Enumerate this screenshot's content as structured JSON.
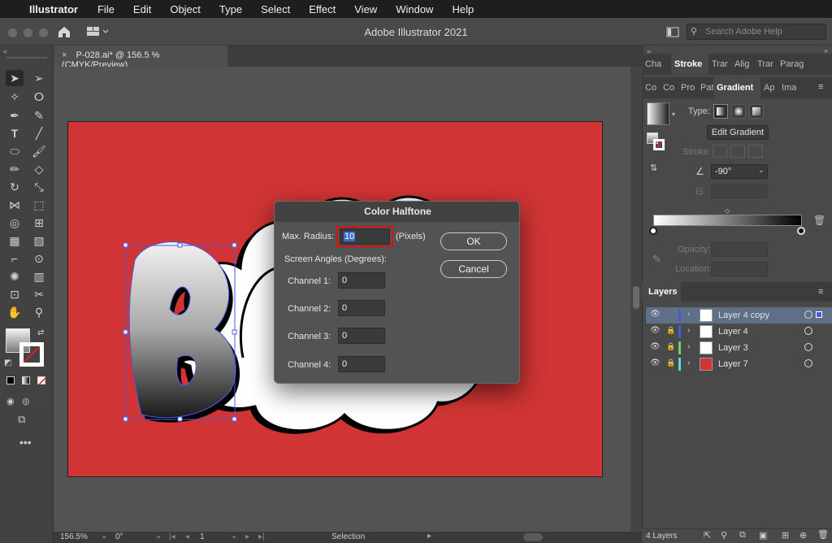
{
  "menubar": {
    "app": "Illustrator",
    "items": [
      "File",
      "Edit",
      "Object",
      "Type",
      "Select",
      "Effect",
      "View",
      "Window",
      "Help"
    ]
  },
  "titlebar": {
    "title": "Adobe Illustrator 2021",
    "search_placeholder": "Search Adobe Help"
  },
  "document": {
    "tab_label": "P-028.ai* @ 156.5 % (CMYK/Preview)"
  },
  "panels": {
    "top_tabs": [
      "Cha",
      "Stroke",
      "Trar",
      "Alig",
      "Trar",
      "Parag"
    ],
    "top_active": "Stroke",
    "gradient_tabs": [
      "Co",
      "Co",
      "Pro",
      "Pat",
      "Gradient",
      "Ap",
      "Ima"
    ],
    "gradient_active": "Gradient",
    "gradient": {
      "type_label": "Type:",
      "edit_button": "Edit Gradient",
      "stroke_label": "Stroke:",
      "angle": "-90°",
      "opacity_label": "Opacity:",
      "location_label": "Location:"
    }
  },
  "layers": {
    "title": "Layers",
    "rows": [
      {
        "name": "Layer 4 copy",
        "color": "#4a5bd8",
        "locked": false,
        "selected": true
      },
      {
        "name": "Layer 4",
        "color": "#4a5bd8",
        "locked": true,
        "selected": false
      },
      {
        "name": "Layer 3",
        "color": "#6cd06c",
        "locked": true,
        "selected": false
      },
      {
        "name": "Layer 7",
        "color": "#5fd6d6",
        "locked": true,
        "selected": false
      }
    ],
    "count": "4 Layers"
  },
  "dialog": {
    "title": "Color Halftone",
    "max_radius_label": "Max. Radius:",
    "max_radius_value": "10",
    "max_radius_unit": "(Pixels)",
    "screen_angles_label": "Screen Angles (Degrees):",
    "channels": [
      {
        "label": "Channel 1:",
        "value": "0"
      },
      {
        "label": "Channel 2:",
        "value": "0"
      },
      {
        "label": "Channel 3:",
        "value": "0"
      },
      {
        "label": "Channel 4:",
        "value": "0"
      }
    ],
    "ok": "OK",
    "cancel": "Cancel"
  },
  "statusbar": {
    "zoom": "156.5%",
    "rotation": "0°",
    "artboard": "1",
    "mode": "Selection"
  }
}
